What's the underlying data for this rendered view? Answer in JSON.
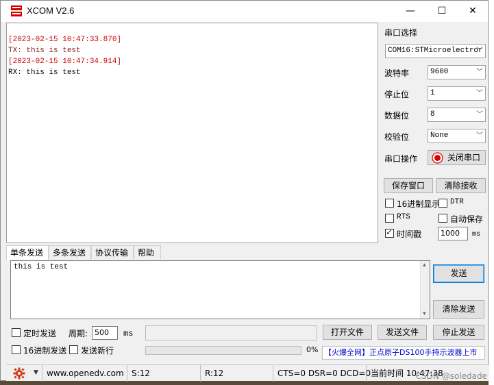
{
  "window": {
    "title": "XCOM V2.6",
    "minimize": "—",
    "maximize": "☐",
    "close": "✕"
  },
  "receive": {
    "lines": [
      {
        "text": "[2023-02-15 10:47:33.870]",
        "color": "#d00000"
      },
      {
        "text": "TX: this is test",
        "color": "#8b1a1a"
      },
      {
        "text": "[2023-02-15 10:47:34.914]",
        "color": "#d00000"
      },
      {
        "text": "RX: this is test",
        "color": "#000000"
      }
    ]
  },
  "right_panel": {
    "port_select_label": "串口选择",
    "port_value": "COM16:STMicroelectror",
    "baud_label": "波特率",
    "baud_value": "9600",
    "stop_label": "停止位",
    "stop_value": "1",
    "data_label": "数据位",
    "data_value": "8",
    "parity_label": "校验位",
    "parity_value": "None",
    "op_label": "串口操作",
    "op_button": "关闭串口",
    "save_window": "保存窗口",
    "clear_receive": "清除接收",
    "hex_display": "16进制显示",
    "dtr": "DTR",
    "rts": "RTS",
    "auto_save": "自动保存",
    "timestamp": "时间戳",
    "timestamp_value": "1000",
    "ms": "ms"
  },
  "tabs": [
    "单条发送",
    "多条发送",
    "协议传输",
    "帮助"
  ],
  "send": {
    "text": "this is test",
    "send_button": "发送",
    "clear_send_button": "清除发送"
  },
  "bottom": {
    "timed_send": "定时发送",
    "period_label": "周期:",
    "period_value": "500",
    "ms": "ms",
    "open_file": "打开文件",
    "send_file": "发送文件",
    "stop_send": "停止发送",
    "hex_send": "16进制发送",
    "send_newline": "发送新行",
    "progress_pct": "0%",
    "ad_text": "【火爆全网】正点原子DS100手持示波器上市"
  },
  "status": {
    "url": "www.openedv.com",
    "s_count": "S:12",
    "r_count": "R:12",
    "signals": "CTS=0 DSR=0 DCD=0",
    "time": "当前时间 10:47:38"
  },
  "watermark": "CSDN @soledade"
}
